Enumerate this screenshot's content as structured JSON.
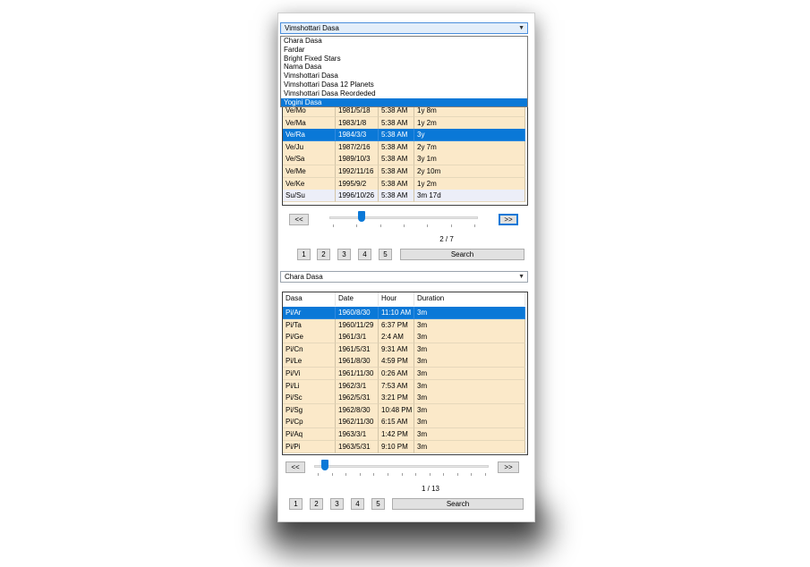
{
  "top_combo": {
    "value": "Vimshottari Dasa",
    "options": [
      "Chara Dasa",
      "Fardar",
      "Bright Fixed Stars",
      "Nama Dasa",
      "Vimshottari Dasa",
      "Vimshottari Dasa 12 Planets",
      "Vimshottari Dasa Reordeded",
      "Yogini Dasa"
    ],
    "highlighted": "Yogini Dasa"
  },
  "top_table": {
    "rows": [
      [
        "Ve/Mo",
        "1981/5/18",
        "5:38 AM",
        "1y 8m"
      ],
      [
        "Ve/Ma",
        "1983/1/8",
        "5:38 AM",
        "1y 2m"
      ],
      [
        "Ve/Ra",
        "1984/3/3",
        "5:38 AM",
        "3y"
      ],
      [
        "Ve/Ju",
        "1987/2/16",
        "5:38 AM",
        "2y 7m"
      ],
      [
        "Ve/Sa",
        "1989/10/3",
        "5:38 AM",
        "3y 1m"
      ],
      [
        "Ve/Me",
        "1992/11/16",
        "5:38 AM",
        "2y 10m"
      ],
      [
        "Ve/Ke",
        "1995/9/2",
        "5:38 AM",
        "1y 2m"
      ],
      [
        "Su/Su",
        "1996/10/26",
        "5:38 AM",
        "3m 17d"
      ]
    ],
    "selected_index": 2,
    "nav": {
      "prev": "<<",
      "next": ">>",
      "page_text": "2 / 7",
      "slider_fraction": 0.17
    },
    "pages": [
      "1",
      "2",
      "3",
      "4",
      "5"
    ],
    "search": "Search"
  },
  "bottom_combo": {
    "value": "Chara Dasa"
  },
  "bottom_table": {
    "headers": [
      "Dasa",
      "Date",
      "Hour",
      "Duration"
    ],
    "rows": [
      [
        "Pi/Ar",
        "1960/8/30",
        "11:10 AM",
        "3m"
      ],
      [
        "Pi/Ta",
        "1960/11/29",
        "6:37 PM",
        "3m"
      ],
      [
        "Pi/Ge",
        "1961/3/1",
        "2:4 AM",
        "3m"
      ],
      [
        "Pi/Cn",
        "1961/5/31",
        "9:31 AM",
        "3m"
      ],
      [
        "Pi/Le",
        "1961/8/30",
        "4:59 PM",
        "3m"
      ],
      [
        "Pi/Vi",
        "1961/11/30",
        "0:26 AM",
        "3m"
      ],
      [
        "Pi/Li",
        "1962/3/1",
        "7:53 AM",
        "3m"
      ],
      [
        "Pi/Sc",
        "1962/5/31",
        "3:21 PM",
        "3m"
      ],
      [
        "Pi/Sg",
        "1962/8/30",
        "10:48 PM",
        "3m"
      ],
      [
        "Pi/Cp",
        "1962/11/30",
        "6:15 AM",
        "3m"
      ],
      [
        "Pi/Aq",
        "1963/3/1",
        "1:42 PM",
        "3m"
      ],
      [
        "Pi/Pi",
        "1963/5/31",
        "9:10 PM",
        "3m"
      ]
    ],
    "selected_index": 0,
    "nav": {
      "prev": "<<",
      "next": ">>",
      "page_text": "1 / 13",
      "slider_fraction": 0.0
    },
    "pages": [
      "1",
      "2",
      "3",
      "4",
      "5"
    ],
    "search": "Search"
  }
}
